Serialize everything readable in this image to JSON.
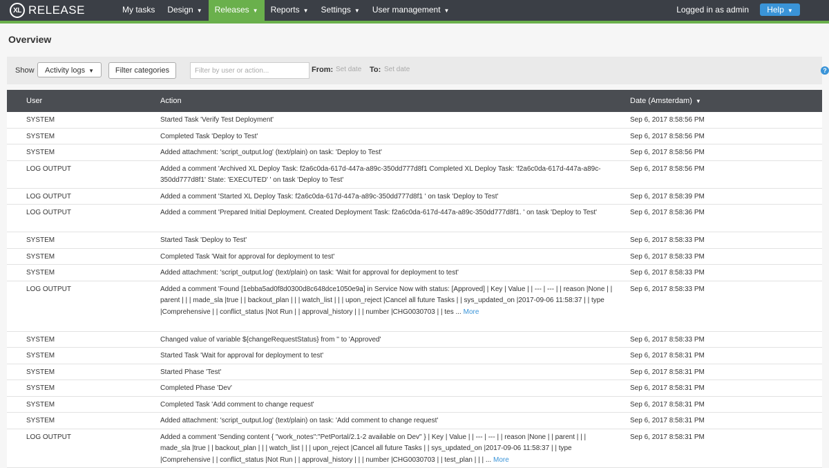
{
  "app": {
    "name": "RELEASE",
    "logo_mark": "XL"
  },
  "nav": {
    "items": [
      {
        "label": "My tasks",
        "caret": false,
        "active": false
      },
      {
        "label": "Design",
        "caret": true,
        "active": false
      },
      {
        "label": "Releases",
        "caret": true,
        "active": true
      },
      {
        "label": "Reports",
        "caret": true,
        "active": false
      },
      {
        "label": "Settings",
        "caret": true,
        "active": false
      },
      {
        "label": "User management",
        "caret": true,
        "active": false
      }
    ],
    "logged_in": "Logged in as admin",
    "help_label": "Help"
  },
  "page": {
    "title": "Overview"
  },
  "filters": {
    "show_label": "Show",
    "show_value": "Activity logs",
    "filter_categories": "Filter categories",
    "search_placeholder": "Filter by user or action...",
    "from_label": "From:",
    "from_value": "Set date",
    "to_label": "To:",
    "to_value": "Set date"
  },
  "table": {
    "headers": {
      "user": "User",
      "action": "Action",
      "date": "Date (Amsterdam)"
    },
    "more_label": "More",
    "rows": [
      {
        "user": "SYSTEM",
        "action": "Started Task 'Verify Test Deployment'",
        "date": "Sep 6, 2017 8:58:56 PM",
        "lines": 1
      },
      {
        "user": "SYSTEM",
        "action": "Completed Task 'Deploy to Test'",
        "date": "Sep 6, 2017 8:58:56 PM",
        "lines": 1
      },
      {
        "user": "SYSTEM",
        "action": "Added attachment: 'script_output.log' (text/plain) on task: 'Deploy to Test'",
        "date": "Sep 6, 2017 8:58:56 PM",
        "lines": 1
      },
      {
        "user": "LOG OUTPUT",
        "action": "Added a comment 'Archived XL Deploy Task: f2a6c0da-617d-447a-a89c-350dd777d8f1 Completed XL Deploy Task: 'f2a6c0da-617d-447a-a89c-350dd777d8f1' State: 'EXECUTED' ' on task 'Deploy to Test'",
        "date": "Sep 6, 2017 8:58:56 PM",
        "lines": 2
      },
      {
        "user": "LOG OUTPUT",
        "action": "Added a comment 'Started XL Deploy Task: f2a6c0da-617d-447a-a89c-350dd777d8f1 ' on task 'Deploy to Test'",
        "date": "Sep 6, 2017 8:58:39 PM",
        "lines": 1
      },
      {
        "user": "LOG OUTPUT",
        "action": "Added a comment 'Prepared Initial Deployment. Created Deployment Task: f2a6c0da-617d-447a-a89c-350dd777d8f1. ' on task 'Deploy to Test'",
        "date": "Sep 6, 2017 8:58:36 PM",
        "lines": 2
      },
      {
        "user": "SYSTEM",
        "action": "Started Task 'Deploy to Test'",
        "date": "Sep 6, 2017 8:58:33 PM",
        "lines": 1
      },
      {
        "user": "SYSTEM",
        "action": "Completed Task 'Wait for approval for deployment to test'",
        "date": "Sep 6, 2017 8:58:33 PM",
        "lines": 1
      },
      {
        "user": "SYSTEM",
        "action": "Added attachment: 'script_output.log' (text/plain) on task: 'Wait for approval for deployment to test'",
        "date": "Sep 6, 2017 8:58:33 PM",
        "lines": 1
      },
      {
        "user": "LOG OUTPUT",
        "action": "Added a comment 'Found [1ebba5ad0f8d0300d8c648dce1050e9a] in Service Now with status: [Approved] | Key | Value | | --- | --- | | reason |None | | parent | | | made_sla |true | | backout_plan | | | watch_list | | | upon_reject |Cancel all future Tasks | | sys_updated_on |2017-09-06 11:58:37 | | type |Comprehensive | | conflict_status |Not Run | | approval_history | | | number |CHG0030703 | | tes ...",
        "date": "Sep 6, 2017 8:58:33 PM",
        "lines": 4,
        "more": true
      },
      {
        "user": "SYSTEM",
        "action": "Changed value of variable ${changeRequestStatus} from '' to 'Approved'",
        "date": "Sep 6, 2017 8:58:33 PM",
        "lines": 1
      },
      {
        "user": "SYSTEM",
        "action": "Started Task 'Wait for approval for deployment to test'",
        "date": "Sep 6, 2017 8:58:31 PM",
        "lines": 1
      },
      {
        "user": "SYSTEM",
        "action": "Started Phase 'Test'",
        "date": "Sep 6, 2017 8:58:31 PM",
        "lines": 1
      },
      {
        "user": "SYSTEM",
        "action": "Completed Phase 'Dev'",
        "date": "Sep 6, 2017 8:58:31 PM",
        "lines": 1
      },
      {
        "user": "SYSTEM",
        "action": "Completed Task 'Add comment to change request'",
        "date": "Sep 6, 2017 8:58:31 PM",
        "lines": 1
      },
      {
        "user": "SYSTEM",
        "action": "Added attachment: 'script_output.log' (text/plain) on task: 'Add comment to change request'",
        "date": "Sep 6, 2017 8:58:31 PM",
        "lines": 1
      },
      {
        "user": "LOG OUTPUT",
        "action": "Added a comment 'Sending content { \"work_notes\":\"PetPortal/2.1-2 available on Dev\" } | Key | Value | | --- | --- | | reason |None | | parent | | | made_sla |true | | backout_plan | | | watch_list | | | upon_reject |Cancel all future Tasks | | sys_updated_on |2017-09-06 11:58:37 | | type |Comprehensive | | conflict_status |Not Run | | approval_history | | | number |CHG0030703 | | test_plan | | | ...",
        "date": "Sep 6, 2017 8:58:31 PM",
        "lines": 3,
        "more": true
      }
    ]
  }
}
